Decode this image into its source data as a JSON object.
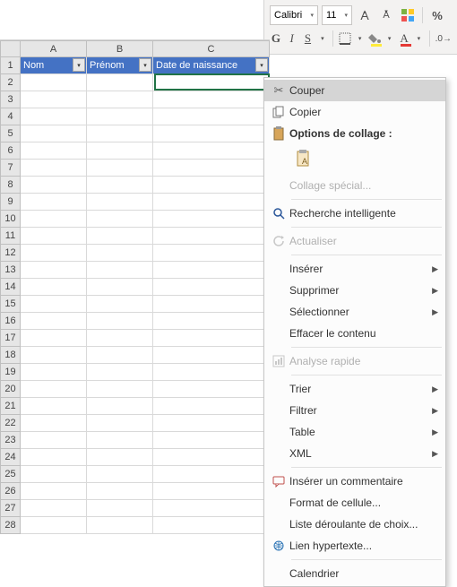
{
  "ribbon": {
    "font_name": "Calibri",
    "font_size": "11",
    "bold": "G",
    "italic": "I",
    "underline": "S",
    "percent": "%"
  },
  "columns": {
    "A": "A",
    "B": "B",
    "C": "C"
  },
  "headers": {
    "nom": "Nom",
    "prenom": "Prénom",
    "date": "Date de naissance"
  },
  "rows": [
    "1",
    "2",
    "3",
    "4",
    "5",
    "6",
    "7",
    "8",
    "9",
    "10",
    "11",
    "12",
    "13",
    "14",
    "15",
    "16",
    "17",
    "18",
    "19",
    "20",
    "21",
    "22",
    "23",
    "24",
    "25",
    "26",
    "27",
    "28"
  ],
  "menu": {
    "cut": "Couper",
    "copy": "Copier",
    "paste_options": "Options de collage :",
    "paste_special": "Collage spécial...",
    "smart_lookup": "Recherche intelligente",
    "refresh": "Actualiser",
    "insert": "Insérer",
    "delete": "Supprimer",
    "select": "Sélectionner",
    "clear": "Effacer le contenu",
    "quick_analysis": "Analyse rapide",
    "sort": "Trier",
    "filter": "Filtrer",
    "table": "Table",
    "xml": "XML",
    "insert_comment": "Insérer un commentaire",
    "format_cells": "Format de cellule...",
    "dropdown_list": "Liste déroulante de choix...",
    "hyperlink": "Lien hypertexte...",
    "calendar": "Calendrier"
  }
}
